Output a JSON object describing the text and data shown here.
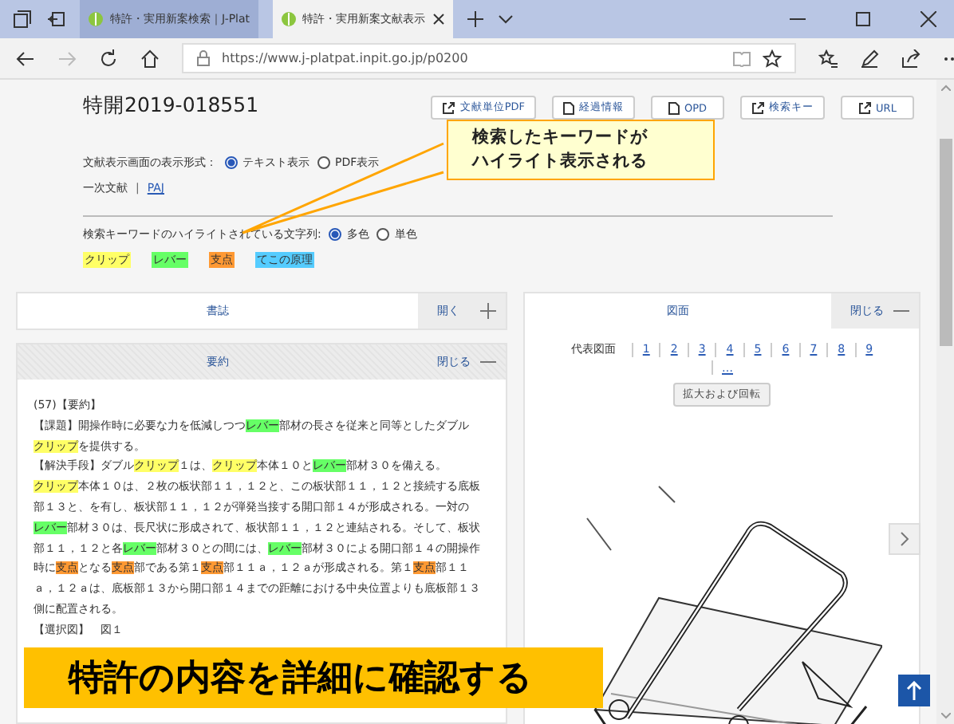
{
  "browser": {
    "tabs": [
      {
        "label": "特許・実用新案検索｜J-Plat",
        "selected": false
      },
      {
        "label": "特許・実用新案文献表示",
        "selected": true
      }
    ],
    "address": "https://www.j-platpat.inpit.go.jp/p0200"
  },
  "document": {
    "title": "特開2019-018551",
    "actions": [
      {
        "label": "文献単位PDF",
        "kind": "external"
      },
      {
        "label": "経過情報",
        "kind": "doc"
      },
      {
        "label": "OPD",
        "kind": "doc"
      },
      {
        "label": "検索キー",
        "kind": "external"
      },
      {
        "label": "URL",
        "kind": "external"
      }
    ],
    "format_label": "文献表示画面の表示形式：",
    "formats": [
      {
        "label": "テキスト表示",
        "selected": true
      },
      {
        "label": "PDF表示",
        "selected": false
      }
    ],
    "primary_label": "一次文献",
    "separator": "|",
    "primary_link": "PAJ",
    "highlight_label": "検索キーワードのハイライトされている文字列:",
    "highlight_modes": [
      {
        "label": "多色",
        "selected": true
      },
      {
        "label": "単色",
        "selected": false
      }
    ],
    "keywords": [
      {
        "text": "クリップ",
        "color": "#ffff66"
      },
      {
        "text": "レバー",
        "color": "#66ff66"
      },
      {
        "text": "支点",
        "color": "#ff9933"
      },
      {
        "text": "てこの原理",
        "color": "#55ccff"
      }
    ]
  },
  "panels": {
    "bibliography": {
      "title": "書誌",
      "toggle": "開く",
      "expanded": false
    },
    "abstract": {
      "title": "要約",
      "toggle": "閉じる",
      "expanded": true,
      "paragraphs": [
        [
          {
            "text": "(57)【要約】"
          }
        ],
        [
          {
            "text": "【課題】開操作時に必要な力を低減しつつ"
          },
          {
            "text": "レバー",
            "color": "#66ff66"
          },
          {
            "text": "部材の長さを従来と同等としたダブル"
          },
          {
            "text": "クリップ",
            "color": "#ffff66"
          },
          {
            "text": "を提供する。"
          }
        ],
        [
          {
            "text": "【解決手段】ダブル"
          },
          {
            "text": "クリップ",
            "color": "#ffff66"
          },
          {
            "text": "１は、"
          },
          {
            "text": "クリップ",
            "color": "#ffff66"
          },
          {
            "text": "本体１０と"
          },
          {
            "text": "レバー",
            "color": "#66ff66"
          },
          {
            "text": "部材３０を備える。"
          },
          {
            "text": "クリップ",
            "color": "#ffff66"
          },
          {
            "text": "本体１０は、２枚の板状部１１，１２と、この板状部１１，１２と接続する底板部１３と、を有し、板状部１１，１２が弾発当接する開口部１４が形成される。一対の"
          },
          {
            "text": "レバー",
            "color": "#66ff66"
          },
          {
            "text": "部材３０は、長尺状に形成されて、板状部１１，１２と連結される。そして、板状部１１，１２と各"
          },
          {
            "text": "レバー",
            "color": "#66ff66"
          },
          {
            "text": "部材３０との間には、"
          },
          {
            "text": "レバー",
            "color": "#66ff66"
          },
          {
            "text": "部材３０による開口部１４の開操作時に"
          },
          {
            "text": "支点",
            "color": "#ff9933"
          },
          {
            "text": "となる"
          },
          {
            "text": "支点",
            "color": "#ff9933"
          },
          {
            "text": "部である第１"
          },
          {
            "text": "支点",
            "color": "#ff9933"
          },
          {
            "text": "部１１ａ，１２ａが形成される。第１"
          },
          {
            "text": "支点",
            "color": "#ff9933"
          },
          {
            "text": "部１１ａ，１２ａは、底板部１３から開口部１４までの距離における中央位置よりも底板部１３側に配置される。"
          }
        ],
        [
          {
            "text": "【選択図】　図１"
          }
        ]
      ]
    },
    "drawings": {
      "title": "図面",
      "toggle": "閉じる",
      "expanded": true,
      "nav_label": "代表図面",
      "figures": [
        "1",
        "2",
        "3",
        "4",
        "5",
        "6",
        "7",
        "8",
        "9"
      ],
      "more": "…",
      "zoom_button": "拡大および回転"
    }
  },
  "callout": [
    "検索したキーワードが",
    "ハイライト表示される"
  ],
  "banner": "特許の内容を詳細に確認する"
}
